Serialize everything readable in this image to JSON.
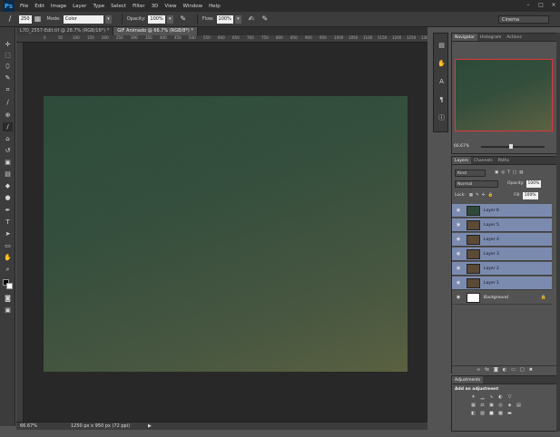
{
  "app": {
    "logo": "Ps"
  },
  "menu": [
    "File",
    "Edit",
    "Image",
    "Layer",
    "Type",
    "Select",
    "Filter",
    "3D",
    "View",
    "Window",
    "Help"
  ],
  "window_controls": [
    "–",
    "□",
    "×"
  ],
  "options_bar": {
    "brush_size": "250",
    "mode_label": "Mode:",
    "mode_value": "Color",
    "opacity_label": "Opacity:",
    "opacity_value": "100%",
    "flow_label": "Flow:",
    "flow_value": "100%",
    "workspace": "Cinema"
  },
  "tabs": [
    {
      "label": "L7D_2557-Edit.tif @ 28.7% (RGB/16*) *",
      "active": false
    },
    {
      "label": "GIF Animado @ 66.7% (RGB/8*) *",
      "active": true
    }
  ],
  "ruler_ticks": [
    "0",
    "50",
    "100",
    "150",
    "200",
    "250",
    "300",
    "350",
    "400",
    "450",
    "500",
    "550",
    "600",
    "650",
    "700",
    "750",
    "800",
    "850",
    "900",
    "950",
    "1000",
    "1050",
    "1100",
    "1150",
    "1200",
    "1250",
    "1300"
  ],
  "status": {
    "zoom": "66.67%",
    "doc_size": "1250 px x 950 px (72 ppi)",
    "arrow": "▶"
  },
  "navigator": {
    "tabs": [
      "Navigator",
      "Histogram",
      "Actions"
    ],
    "zoom": "66.67%"
  },
  "layers_panel": {
    "tabs": [
      "Layers",
      "Channels",
      "Paths"
    ],
    "kind": "Kind",
    "blend_mode": "Normal",
    "opacity_label": "Opacity:",
    "opacity_value": "100%",
    "lock_label": "Lock:",
    "fill_label": "Fill:",
    "fill_value": "100%",
    "layers": [
      {
        "name": "Layer 6",
        "selected": true,
        "thumb": "#2f4a3a"
      },
      {
        "name": "Layer 5",
        "selected": true,
        "thumb": "#5b4a36"
      },
      {
        "name": "Layer 4",
        "selected": true,
        "thumb": "#5b4a36"
      },
      {
        "name": "Layer 3",
        "selected": true,
        "thumb": "#5b4a36"
      },
      {
        "name": "Layer 2",
        "selected": true,
        "thumb": "#5b4a36"
      },
      {
        "name": "Layer 1",
        "selected": true,
        "thumb": "#5b4a36"
      },
      {
        "name": "Background",
        "selected": false,
        "thumb": "#ffffff"
      }
    ]
  },
  "adjustments": {
    "tab": "Adjustments",
    "title": "Add an adjustment"
  },
  "colors": {
    "selected_layer": "#7b8bb0",
    "navigator_box": "#e0353a"
  }
}
